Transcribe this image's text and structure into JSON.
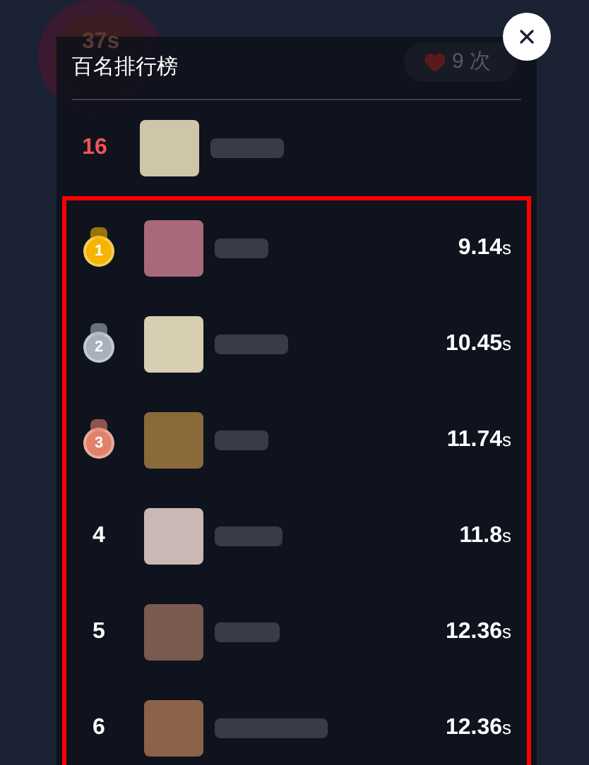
{
  "background": {
    "timer": "37s",
    "lives": "9 次"
  },
  "leaderboard": {
    "title": "百名排行榜",
    "highlighted": true,
    "my_entry": {
      "rank": "16"
    },
    "entries": [
      {
        "kind": "medal",
        "rank": "1",
        "color": "#f5b400",
        "time": "9.14",
        "unit": "s"
      },
      {
        "kind": "medal",
        "rank": "2",
        "color": "#a9b0bb",
        "time": "10.45",
        "unit": "s"
      },
      {
        "kind": "medal",
        "rank": "3",
        "color": "#e0826a",
        "time": "11.74",
        "unit": "s"
      },
      {
        "kind": "number",
        "rank": "4",
        "time": "11.8",
        "unit": "s"
      },
      {
        "kind": "number",
        "rank": "5",
        "time": "12.36",
        "unit": "s"
      },
      {
        "kind": "number",
        "rank": "6",
        "time": "12.36",
        "unit": "s"
      }
    ]
  }
}
